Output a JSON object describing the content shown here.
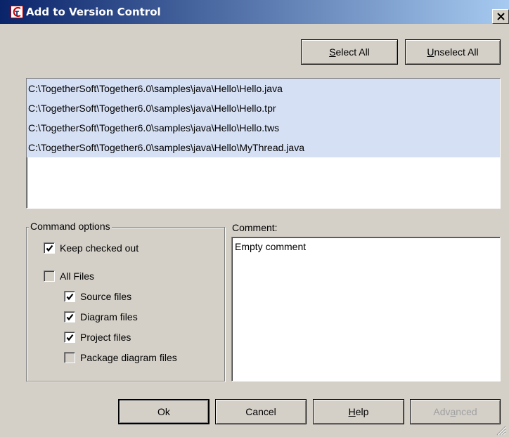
{
  "window": {
    "title": "Add to Version Control",
    "icon": "together-app-icon",
    "close_icon": "close-icon"
  },
  "top_buttons": {
    "select_all_prefix": "",
    "select_all_mnemonic": "S",
    "select_all_rest": "elect All",
    "unselect_all_prefix": "",
    "unselect_all_mnemonic": "U",
    "unselect_all_rest": "nselect All"
  },
  "files": [
    "C:\\TogetherSoft\\Together6.0\\samples\\java\\Hello\\Hello.java",
    "C:\\TogetherSoft\\Together6.0\\samples\\java\\Hello\\Hello.tpr",
    "C:\\TogetherSoft\\Together6.0\\samples\\java\\Hello\\Hello.tws",
    "C:\\TogetherSoft\\Together6.0\\samples\\java\\Hello\\MyThread.java"
  ],
  "command_options": {
    "legend": "Command options",
    "keep_checked_out": {
      "label": "Keep checked out",
      "checked": true
    },
    "all_files": {
      "label": "All Files",
      "checked": false
    },
    "source_files": {
      "label": "Source files",
      "checked": true
    },
    "diagram_files": {
      "label": "Diagram files",
      "checked": true
    },
    "project_files": {
      "label": "Project files",
      "checked": true
    },
    "package_diagram_files": {
      "label": "Package diagram files",
      "checked": false
    }
  },
  "comment": {
    "label": "Comment:",
    "value": "Empty comment"
  },
  "bottom_buttons": {
    "ok": "Ok",
    "cancel": "Cancel",
    "help_prefix": "",
    "help_mnemonic": "H",
    "help_rest": "elp",
    "advanced_prefix": "Adv",
    "advanced_mnemonic": "a",
    "advanced_rest": "nced",
    "advanced_enabled": false
  },
  "colors": {
    "title_gradient_start": "#0a246a",
    "title_gradient_end": "#a6caf0",
    "face": "#d4d0c8",
    "selection": "#d6e0f4"
  }
}
